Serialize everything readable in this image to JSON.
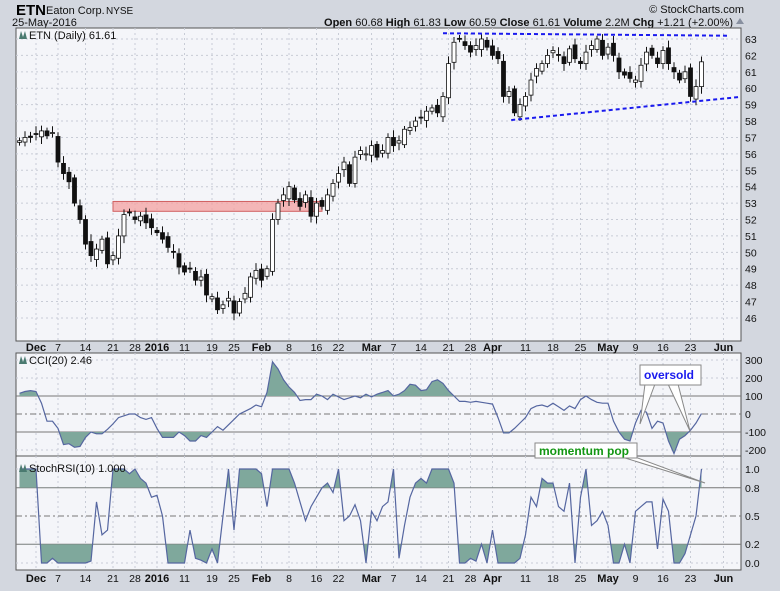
{
  "header": {
    "symbol": "ETN",
    "company": "Eaton Corp.",
    "exchange": "NYSE",
    "date": "25-May-2016",
    "copyright": "© StockCharts.com",
    "open_label": "Open",
    "open": "60.68",
    "high_label": "High",
    "high": "61.83",
    "low_label": "Low",
    "low": "60.59",
    "close_label": "Close",
    "close": "61.61",
    "volume_label": "Volume",
    "volume": "2.2M",
    "chg_label": "Chg",
    "chg": "+1.21 (+2.00%)"
  },
  "colors": {
    "fill": "#7fa89c",
    "line": "#5566a0",
    "trend": "#1a1aee",
    "zone": "#f4a0a0",
    "up": "#ffffff",
    "down": "#111111"
  },
  "chart_data": [
    {
      "type": "candlestick",
      "title": "ETN (Daily) 61.61",
      "ylim": [
        45,
        63.6
      ],
      "yticks": [
        46,
        47,
        48,
        49,
        50,
        51,
        52,
        53,
        54,
        55,
        56,
        57,
        58,
        59,
        60,
        61,
        62,
        63
      ],
      "closes": [
        56.8,
        57.0,
        57.0,
        57.2,
        57.4,
        57.1,
        57.3,
        55.5,
        54.8,
        54.3,
        53.0,
        52.0,
        50.5,
        49.8,
        50.2,
        50.8,
        49.3,
        49.8,
        51.0,
        52.3,
        52.4,
        52.0,
        52.2,
        51.8,
        51.5,
        51.2,
        50.8,
        50.3,
        50.0,
        49.1,
        48.8,
        49.0,
        48.3,
        48.5,
        47.4,
        47.3,
        46.5,
        46.8,
        47.2,
        46.3,
        47.0,
        47.5,
        48.5,
        48.9,
        48.3,
        49.0,
        52.0,
        53.0,
        53.5,
        54.0,
        53.2,
        52.8,
        53.5,
        52.2,
        53.0,
        52.8,
        53.5,
        54.2,
        54.8,
        55.5,
        54.2,
        55.8,
        56.2,
        56.0,
        56.5,
        55.8,
        56.2,
        57.0,
        56.5,
        56.8,
        57.5,
        57.6,
        58.0,
        58.2,
        58.6,
        58.8,
        58.5,
        59.5,
        61.5,
        62.8,
        63.0,
        62.6,
        62.2,
        62.6,
        63.0,
        62.5,
        62.0,
        61.8,
        59.5,
        59.8,
        58.5,
        59.0,
        59.5,
        60.5,
        61.2,
        61.5,
        62.0,
        62.3,
        62.0,
        61.5,
        62.4,
        61.8,
        61.5,
        62.2,
        62.6,
        63.0,
        62.0,
        62.5,
        62.0,
        61.0,
        60.8,
        60.6,
        60.5,
        61.4,
        62.2,
        62.0,
        61.5,
        62.3,
        61.5,
        61.0,
        60.5,
        61.0,
        59.5,
        60.1,
        61.61
      ],
      "annotations": {
        "resistance_zone": {
          "from_index": 17,
          "to_index": 55,
          "low": 52.5,
          "high": 53.1
        },
        "upper_trendline": {
          "from": [
            77,
            63.35
          ],
          "to": [
            129,
            63.2
          ]
        },
        "lower_trendline": {
          "from": [
            89.4,
            58.06
          ],
          "to": [
            131,
            59.47
          ]
        }
      }
    },
    {
      "type": "area",
      "title": "CCI(20) 2.46",
      "ylim": [
        -250,
        320
      ],
      "yticks": [
        300,
        200,
        100,
        0,
        -100,
        -200
      ],
      "thresholds": [
        100,
        -100
      ],
      "values": [
        115,
        125,
        130,
        125,
        60,
        -40,
        -40,
        -80,
        -170,
        -165,
        -185,
        -180,
        -130,
        -100,
        -110,
        -110,
        -85,
        -55,
        -20,
        -10,
        0,
        0,
        -20,
        -30,
        -20,
        -80,
        -130,
        -130,
        -130,
        -100,
        -120,
        -150,
        -150,
        -120,
        -130,
        -100,
        -70,
        -90,
        -60,
        -30,
        0,
        15,
        30,
        50,
        40,
        120,
        290,
        250,
        190,
        150,
        120,
        75,
        80,
        80,
        110,
        100,
        80,
        110,
        95,
        80,
        90,
        100,
        90,
        110,
        95,
        110,
        120,
        130,
        100,
        110,
        130,
        165,
        160,
        130,
        135,
        180,
        190,
        170,
        130,
        100,
        70,
        70,
        65,
        70,
        65,
        60,
        55,
        -20,
        -105,
        -105,
        -80,
        -50,
        -20,
        30,
        45,
        50,
        40,
        60,
        40,
        20,
        45,
        30,
        80,
        100,
        80,
        65,
        60,
        60,
        -40,
        -100,
        -140,
        -150,
        -50,
        20,
        10,
        -80,
        -40,
        -50,
        -150,
        -220,
        -140,
        -120,
        -90,
        -50,
        2.46
      ],
      "callout": "oversold"
    },
    {
      "type": "area",
      "title": "StochRSI(10) 1.000",
      "ylim": [
        -0.08,
        1.08
      ],
      "yticks": [
        1.0,
        0.8,
        0.5,
        0.2,
        0.0
      ],
      "ytick_labels": [
        "1.0",
        "0.8",
        "0.5",
        "0.2",
        "0.0"
      ],
      "thresholds": [
        0.8,
        0.2
      ],
      "values": [
        1,
        1,
        1,
        1,
        0,
        0,
        0.05,
        0,
        0,
        0,
        0,
        0,
        0,
        0.02,
        0.65,
        0.3,
        0.35,
        1,
        1,
        1,
        0.95,
        1,
        0.9,
        0.85,
        0.7,
        0.72,
        0.5,
        0,
        0,
        0,
        0,
        0.35,
        0.05,
        0.03,
        0,
        0.15,
        0,
        0.5,
        1,
        0.35,
        1,
        1,
        1,
        1,
        0.95,
        0.6,
        1,
        1,
        1,
        1,
        0.85,
        0.65,
        0.45,
        0.6,
        0.7,
        0.8,
        0.85,
        0.75,
        1,
        0.45,
        0.5,
        0.62,
        0.45,
        0,
        0.55,
        0.45,
        0.6,
        0.65,
        1,
        0.05,
        0.4,
        0.7,
        0.85,
        0.9,
        0.85,
        1,
        1,
        1,
        1,
        0.85,
        0,
        0,
        0.05,
        0.02,
        0.2,
        0,
        0.35,
        0,
        0,
        0,
        0,
        0.05,
        0.3,
        0.7,
        0.6,
        0.9,
        0.85,
        0.85,
        0.6,
        0.55,
        0.85,
        0,
        0.7,
        1,
        0.4,
        0.45,
        0.55,
        0.4,
        0,
        0,
        0.2,
        0,
        0.55,
        0.6,
        0.65,
        0.65,
        0.15,
        0.68,
        0.55,
        0,
        0,
        0.1,
        0.3,
        0.5,
        1.0
      ],
      "callout": "momentum pop"
    }
  ],
  "x_labels": [
    {
      "label": "Dec",
      "index": 3,
      "bold": true
    },
    {
      "label": "7",
      "index": 7
    },
    {
      "label": "14",
      "index": 12
    },
    {
      "label": "21",
      "index": 17
    },
    {
      "label": "28",
      "index": 21
    },
    {
      "label": "2016",
      "index": 25,
      "bold": true
    },
    {
      "label": "11",
      "index": 30
    },
    {
      "label": "19",
      "index": 35
    },
    {
      "label": "25",
      "index": 39
    },
    {
      "label": "Feb",
      "index": 44,
      "bold": true
    },
    {
      "label": "8",
      "index": 49
    },
    {
      "label": "16",
      "index": 54
    },
    {
      "label": "22",
      "index": 58
    },
    {
      "label": "Mar",
      "index": 64,
      "bold": true
    },
    {
      "label": "7",
      "index": 68
    },
    {
      "label": "14",
      "index": 73
    },
    {
      "label": "21",
      "index": 78
    },
    {
      "label": "28",
      "index": 82
    },
    {
      "label": "Apr",
      "index": 86,
      "bold": true
    },
    {
      "label": "11",
      "index": 92
    },
    {
      "label": "18",
      "index": 97
    },
    {
      "label": "25",
      "index": 102
    },
    {
      "label": "May",
      "index": 107,
      "bold": true
    },
    {
      "label": "9",
      "index": 112
    },
    {
      "label": "16",
      "index": 117
    },
    {
      "label": "23",
      "index": 122
    },
    {
      "label": "Jun",
      "index": 128,
      "bold": true
    }
  ]
}
